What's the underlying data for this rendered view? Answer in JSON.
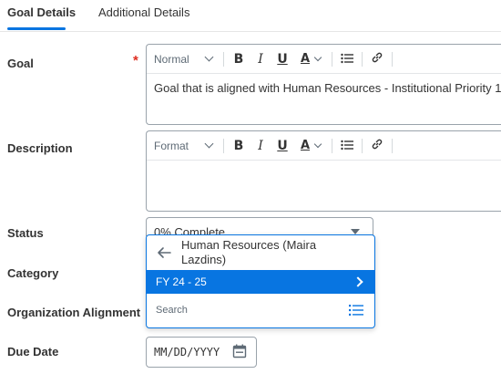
{
  "tabs": [
    {
      "label": "Goal Details",
      "active": true
    },
    {
      "label": "Additional Details",
      "active": false
    }
  ],
  "fields": {
    "goal_label": "Goal",
    "goal_required_mark": "*",
    "description_label": "Description",
    "status_label": "Status",
    "category_label": "Category",
    "org_alignment_label": "Organization Alignment",
    "due_date_label": "Due Date"
  },
  "goal_editor": {
    "format_select": "Normal",
    "value": "Goal that is aligned with Human Resources - Institutional Priority 1"
  },
  "description_editor": {
    "format_select": "Format",
    "value": ""
  },
  "toolbar": {
    "bold": "B",
    "italic": "I",
    "underline": "U",
    "font_color": "A"
  },
  "status": {
    "value": "0% Complete"
  },
  "dropdown": {
    "header": "Human Resources (Maira Lazdins)",
    "items": [
      {
        "label": "FY 24 - 25",
        "selected": true
      }
    ],
    "search_placeholder": "Search"
  },
  "due_date": {
    "placeholder": "MM/DD/YYYY"
  },
  "colors": {
    "accent": "#0875e1",
    "required": "#de2e21",
    "text": "#333333"
  },
  "icons": {
    "back": "arrow-left-icon",
    "next": "chevron-right-icon",
    "list": "list-icon",
    "calendar": "calendar-icon",
    "link": "link-icon",
    "bullets": "bulleted-list-icon"
  }
}
